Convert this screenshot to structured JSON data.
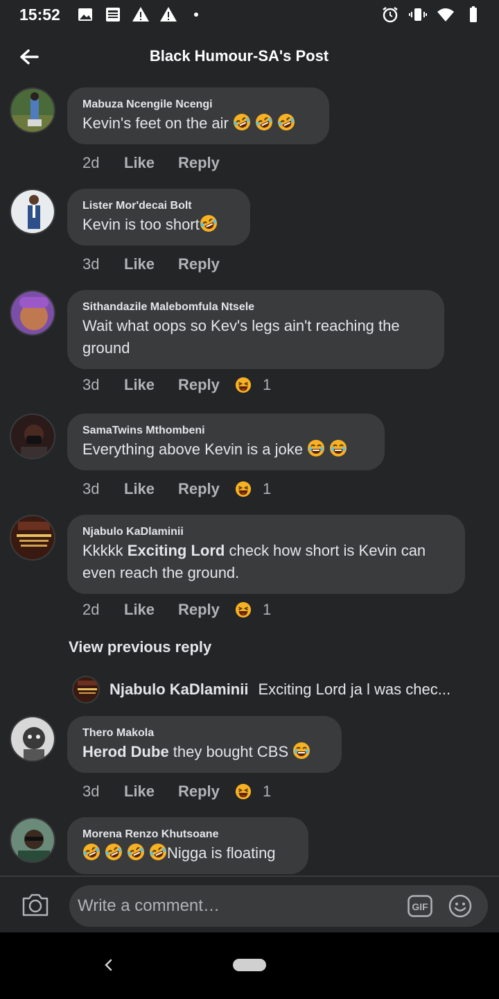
{
  "status_bar": {
    "time": "15:52",
    "left_icons": [
      "gallery-icon",
      "news-icon",
      "warning-icon",
      "warning-icon",
      "dot-icon"
    ],
    "right_icons": [
      "alarm-icon",
      "vibrate-icon",
      "wifi-icon",
      "battery-icon"
    ]
  },
  "header": {
    "title": "Black Humour-SA's Post",
    "back_icon": "arrow-left-icon"
  },
  "comments": [
    {
      "author": "Mabuza Ncengile Ncengi",
      "text": "Kevin's feet on the air",
      "emojis": [
        "rofl",
        "rofl",
        "rofl"
      ],
      "time": "2d",
      "like": "Like",
      "reply": "Reply",
      "reactions": ""
    },
    {
      "author": "Lister Mor'decai Bolt",
      "text": "Kevin is too short",
      "emojis": [
        "rofl"
      ],
      "time": "3d",
      "like": "Like",
      "reply": "Reply",
      "reactions": ""
    },
    {
      "author": "Sithandazile Malebomfula Ntsele",
      "text": "Wait what oops so Kev's legs ain't reaching the ground",
      "time": "3d",
      "like": "Like",
      "reply": "Reply",
      "reactions": "1"
    },
    {
      "author": "SamaTwins Mthombeni",
      "text": "Everything above Kevin is a joke",
      "emojis": [
        "joy",
        "joy"
      ],
      "time": "3d",
      "like": "Like",
      "reply": "Reply",
      "reactions": "1"
    },
    {
      "author": "Njabulo KaDlaminii",
      "mention": "Exciting Lord",
      "text": " check how short is Kevin can even reach the ground.",
      "time": "2d",
      "like": "Like",
      "reply": "Reply",
      "reactions": "1"
    },
    {
      "author": "Thero Makola",
      "mention": "Herod Dube",
      "text": " they bought CBS",
      "emojis": [
        "joy"
      ],
      "time": "3d",
      "like": "Like",
      "reply": "Reply",
      "reactions": "1"
    },
    {
      "author": "Morena Renzo Khutsoane",
      "emojis": [
        "rofl",
        "rofl",
        "rofl",
        "rofl"
      ],
      "text": "Nigga is floating"
    }
  ],
  "thread": {
    "view_previous": "View previous reply",
    "reply_author": "Njabulo KaDlaminii",
    "reply_text": "Exciting Lord ja l was chec..."
  },
  "composer": {
    "placeholder": "Write a comment…",
    "gif_label": "GIF"
  },
  "colors": {
    "background": "#242526",
    "bubble": "#3a3b3c",
    "text": "#e4e6eb",
    "secondary": "#b0b3b8",
    "emoji_yellow": "#f7b125"
  }
}
